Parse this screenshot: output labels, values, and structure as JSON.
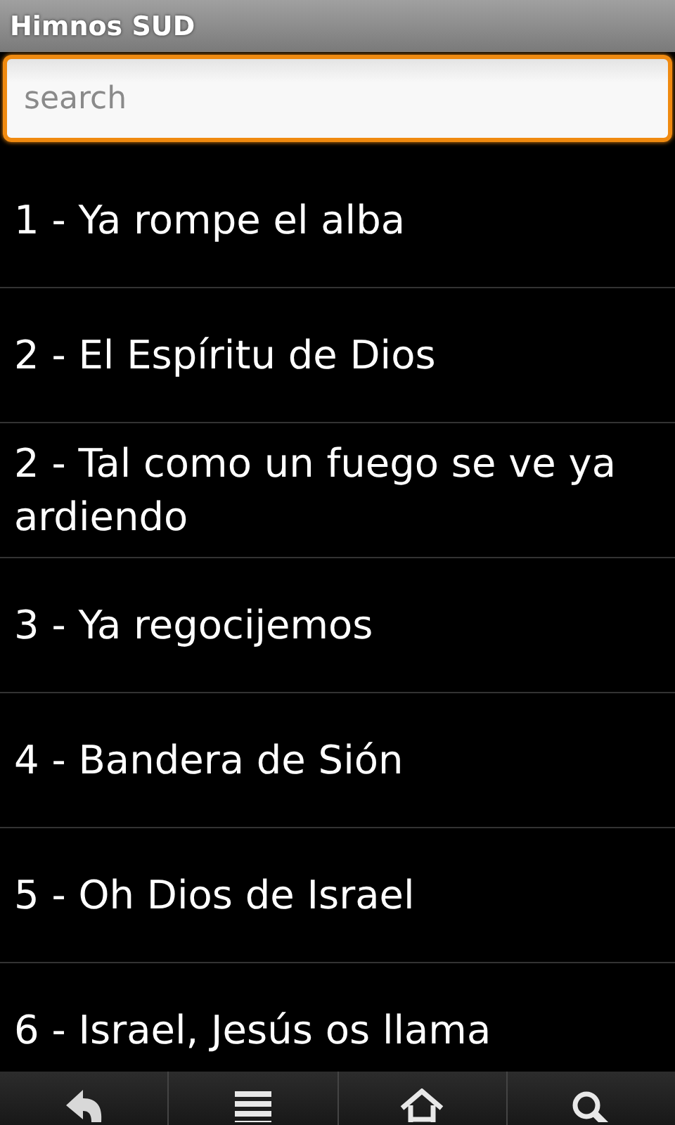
{
  "window": {
    "title": "Himnos SUD"
  },
  "search": {
    "placeholder": "search",
    "focused": true
  },
  "hymns": [
    {
      "label": "1 - Ya rompe el alba"
    },
    {
      "label": "2 - El Espíritu de Dios"
    },
    {
      "label": "2 - Tal como un fuego se ve ya ardiendo"
    },
    {
      "label": "3 - Ya regocijemos"
    },
    {
      "label": "4 - Bandera de Sión"
    },
    {
      "label": "5 - Oh Dios de Israel"
    },
    {
      "label": "6 - Israel, Jesús os llama"
    }
  ],
  "bottom_bar": [
    {
      "kind": "back"
    },
    {
      "kind": "menu"
    },
    {
      "kind": "home"
    },
    {
      "kind": "search"
    }
  ]
}
